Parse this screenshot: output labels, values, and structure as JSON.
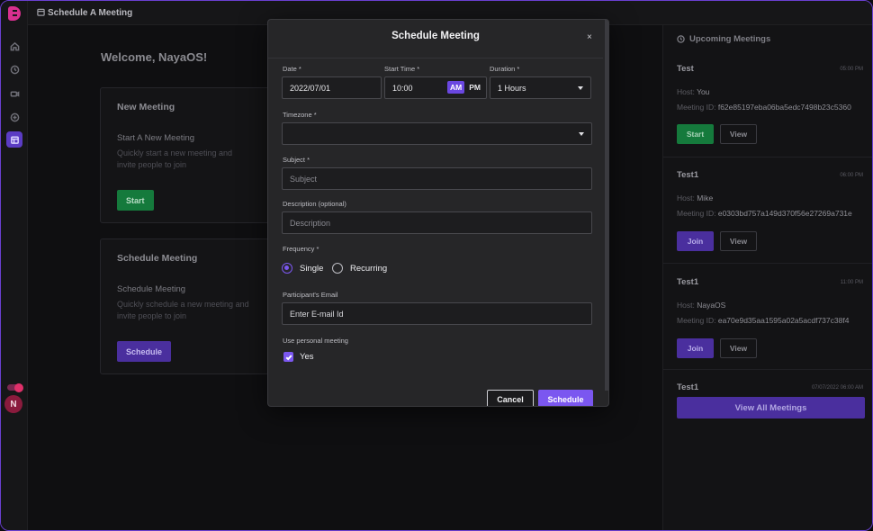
{
  "topbar": {
    "title": "Schedule A Meeting"
  },
  "user": {
    "avatar_initial": "N"
  },
  "main": {
    "welcome": "Welcome, NayaOS!",
    "new_meeting": {
      "title": "New Meeting",
      "subtitle": "Start A New Meeting",
      "description": "Quickly start a new meeting and invite people to join",
      "button": "Start"
    },
    "schedule_meeting": {
      "title": "Schedule Meeting",
      "subtitle": "Schedule Meeting",
      "description": "Quickly schedule a new meeting and invite people to join",
      "button": "Schedule"
    }
  },
  "upcoming": {
    "title": "Upcoming Meetings",
    "host_label": "Host:",
    "id_label": "Meeting ID:",
    "meetings": [
      {
        "name": "Test",
        "time": "05:00 PM",
        "host": "You",
        "id": "f62e85197eba06ba5edc7498b23c5360",
        "action": "Start",
        "view": "View"
      },
      {
        "name": "Test1",
        "time": "06:00 PM",
        "host": "Mike",
        "id": "e0303bd757a149d370f56e27269a731e",
        "action": "Join",
        "view": "View"
      },
      {
        "name": "Test1",
        "time": "11:00 PM",
        "host": "NayaOS",
        "id": "ea70e9d35aa1595a02a5acdf737c38f4",
        "action": "Join",
        "view": "View"
      },
      {
        "name": "Test1",
        "time": "07/07/2022 06:00 AM"
      }
    ],
    "view_all": "View All Meetings"
  },
  "modal": {
    "title": "Schedule Meeting",
    "close": "×",
    "date": {
      "label": "Date *",
      "value": "2022/07/01"
    },
    "start_time": {
      "label": "Start Time *",
      "value": "10:00",
      "am": "AM",
      "pm": "PM",
      "selected": "AM"
    },
    "duration": {
      "label": "Duration *",
      "value": "1 Hours"
    },
    "timezone": {
      "label": "Timezone *",
      "value": ""
    },
    "subject": {
      "label": "Subject *",
      "placeholder": "Subject"
    },
    "description": {
      "label": "Description (optional)",
      "placeholder": "Description"
    },
    "frequency": {
      "label": "Frequency *",
      "options": [
        "Single",
        "Recurring"
      ],
      "selected": "Single"
    },
    "email": {
      "label": "Participant's Email",
      "placeholder": "Enter E-mail Id"
    },
    "personal": {
      "label": "Use personal meeting",
      "option": "Yes",
      "checked": true
    },
    "cancel": "Cancel",
    "submit": "Schedule"
  },
  "colors": {
    "accent": "#7b57f0",
    "green": "#157a3c",
    "brand": "#d8308f"
  }
}
